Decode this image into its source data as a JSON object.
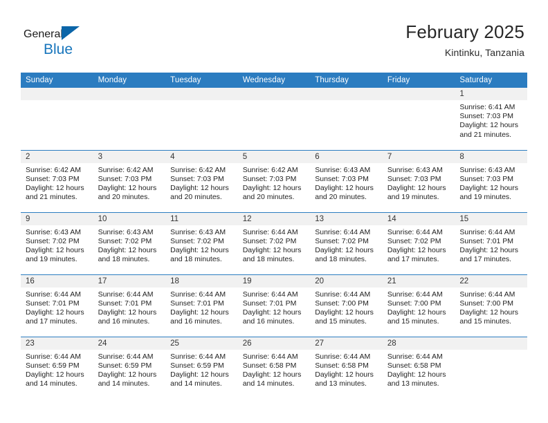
{
  "brand": {
    "name_part1": "General",
    "name_part2": "Blue",
    "logo_icon": "triangle-logo-icon"
  },
  "header": {
    "title": "February 2025",
    "subtitle": "Kintinku, Tanzania"
  },
  "calendar": {
    "weekday_headers": [
      "Sunday",
      "Monday",
      "Tuesday",
      "Wednesday",
      "Thursday",
      "Friday",
      "Saturday"
    ],
    "accent_color": "#2b7cc0",
    "daynum_band_color": "#f1f1f1",
    "weeks": [
      [
        {
          "day": "",
          "blank": true
        },
        {
          "day": "",
          "blank": true
        },
        {
          "day": "",
          "blank": true
        },
        {
          "day": "",
          "blank": true
        },
        {
          "day": "",
          "blank": true
        },
        {
          "day": "",
          "blank": true
        },
        {
          "day": "1",
          "sunrise": "Sunrise: 6:41 AM",
          "sunset": "Sunset: 7:03 PM",
          "daylight": "Daylight: 12 hours and 21 minutes."
        }
      ],
      [
        {
          "day": "2",
          "sunrise": "Sunrise: 6:42 AM",
          "sunset": "Sunset: 7:03 PM",
          "daylight": "Daylight: 12 hours and 21 minutes."
        },
        {
          "day": "3",
          "sunrise": "Sunrise: 6:42 AM",
          "sunset": "Sunset: 7:03 PM",
          "daylight": "Daylight: 12 hours and 20 minutes."
        },
        {
          "day": "4",
          "sunrise": "Sunrise: 6:42 AM",
          "sunset": "Sunset: 7:03 PM",
          "daylight": "Daylight: 12 hours and 20 minutes."
        },
        {
          "day": "5",
          "sunrise": "Sunrise: 6:42 AM",
          "sunset": "Sunset: 7:03 PM",
          "daylight": "Daylight: 12 hours and 20 minutes."
        },
        {
          "day": "6",
          "sunrise": "Sunrise: 6:43 AM",
          "sunset": "Sunset: 7:03 PM",
          "daylight": "Daylight: 12 hours and 20 minutes."
        },
        {
          "day": "7",
          "sunrise": "Sunrise: 6:43 AM",
          "sunset": "Sunset: 7:03 PM",
          "daylight": "Daylight: 12 hours and 19 minutes."
        },
        {
          "day": "8",
          "sunrise": "Sunrise: 6:43 AM",
          "sunset": "Sunset: 7:03 PM",
          "daylight": "Daylight: 12 hours and 19 minutes."
        }
      ],
      [
        {
          "day": "9",
          "sunrise": "Sunrise: 6:43 AM",
          "sunset": "Sunset: 7:02 PM",
          "daylight": "Daylight: 12 hours and 19 minutes."
        },
        {
          "day": "10",
          "sunrise": "Sunrise: 6:43 AM",
          "sunset": "Sunset: 7:02 PM",
          "daylight": "Daylight: 12 hours and 18 minutes."
        },
        {
          "day": "11",
          "sunrise": "Sunrise: 6:43 AM",
          "sunset": "Sunset: 7:02 PM",
          "daylight": "Daylight: 12 hours and 18 minutes."
        },
        {
          "day": "12",
          "sunrise": "Sunrise: 6:44 AM",
          "sunset": "Sunset: 7:02 PM",
          "daylight": "Daylight: 12 hours and 18 minutes."
        },
        {
          "day": "13",
          "sunrise": "Sunrise: 6:44 AM",
          "sunset": "Sunset: 7:02 PM",
          "daylight": "Daylight: 12 hours and 18 minutes."
        },
        {
          "day": "14",
          "sunrise": "Sunrise: 6:44 AM",
          "sunset": "Sunset: 7:02 PM",
          "daylight": "Daylight: 12 hours and 17 minutes."
        },
        {
          "day": "15",
          "sunrise": "Sunrise: 6:44 AM",
          "sunset": "Sunset: 7:01 PM",
          "daylight": "Daylight: 12 hours and 17 minutes."
        }
      ],
      [
        {
          "day": "16",
          "sunrise": "Sunrise: 6:44 AM",
          "sunset": "Sunset: 7:01 PM",
          "daylight": "Daylight: 12 hours and 17 minutes."
        },
        {
          "day": "17",
          "sunrise": "Sunrise: 6:44 AM",
          "sunset": "Sunset: 7:01 PM",
          "daylight": "Daylight: 12 hours and 16 minutes."
        },
        {
          "day": "18",
          "sunrise": "Sunrise: 6:44 AM",
          "sunset": "Sunset: 7:01 PM",
          "daylight": "Daylight: 12 hours and 16 minutes."
        },
        {
          "day": "19",
          "sunrise": "Sunrise: 6:44 AM",
          "sunset": "Sunset: 7:01 PM",
          "daylight": "Daylight: 12 hours and 16 minutes."
        },
        {
          "day": "20",
          "sunrise": "Sunrise: 6:44 AM",
          "sunset": "Sunset: 7:00 PM",
          "daylight": "Daylight: 12 hours and 15 minutes."
        },
        {
          "day": "21",
          "sunrise": "Sunrise: 6:44 AM",
          "sunset": "Sunset: 7:00 PM",
          "daylight": "Daylight: 12 hours and 15 minutes."
        },
        {
          "day": "22",
          "sunrise": "Sunrise: 6:44 AM",
          "sunset": "Sunset: 7:00 PM",
          "daylight": "Daylight: 12 hours and 15 minutes."
        }
      ],
      [
        {
          "day": "23",
          "sunrise": "Sunrise: 6:44 AM",
          "sunset": "Sunset: 6:59 PM",
          "daylight": "Daylight: 12 hours and 14 minutes."
        },
        {
          "day": "24",
          "sunrise": "Sunrise: 6:44 AM",
          "sunset": "Sunset: 6:59 PM",
          "daylight": "Daylight: 12 hours and 14 minutes."
        },
        {
          "day": "25",
          "sunrise": "Sunrise: 6:44 AM",
          "sunset": "Sunset: 6:59 PM",
          "daylight": "Daylight: 12 hours and 14 minutes."
        },
        {
          "day": "26",
          "sunrise": "Sunrise: 6:44 AM",
          "sunset": "Sunset: 6:58 PM",
          "daylight": "Daylight: 12 hours and 14 minutes."
        },
        {
          "day": "27",
          "sunrise": "Sunrise: 6:44 AM",
          "sunset": "Sunset: 6:58 PM",
          "daylight": "Daylight: 12 hours and 13 minutes."
        },
        {
          "day": "28",
          "sunrise": "Sunrise: 6:44 AM",
          "sunset": "Sunset: 6:58 PM",
          "daylight": "Daylight: 12 hours and 13 minutes."
        },
        {
          "day": "",
          "blank": true
        }
      ]
    ]
  }
}
